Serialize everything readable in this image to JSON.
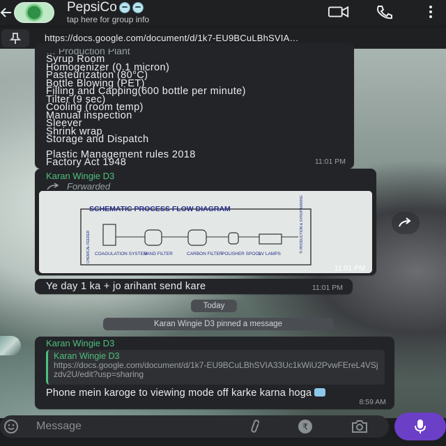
{
  "header": {
    "group_name": "PepsiCo",
    "subtitle": "tap here for group info",
    "icons": [
      "back-arrow-icon",
      "video-call-icon",
      "phone-icon",
      "more-options-icon"
    ]
  },
  "pinned": {
    "text": "https://docs.google.com/document/d/1k7-EU9BCuLBhSVIA…"
  },
  "messages": {
    "m1": {
      "cut_line": "… Production Plant",
      "lines": [
        "Syrup Room",
        "Homogenizer (0.1 micron)",
        "Pasteurization (80°C)",
        "Bottle Blowing (PET)",
        "Filling and Capping(600 bottle per minute)",
        "Tilter (9 sec)",
        "Cooling (room temp)",
        "Manual inspection",
        "Sleever",
        "Shrink wrap",
        "Storage and Dispatch"
      ],
      "lines2": [
        "Plastic Management rules 2018",
        "Factory Act 1948"
      ],
      "time": "11:01 PM"
    },
    "m2": {
      "sender": "Karan Wingie D3",
      "forwarded": "Forwarded",
      "diagram_title": "SCHEMATIC PROCESS FLOW DIAGRAM",
      "diagram_side": "CHEMICAL FEEDER",
      "diagram_right": "TI PRODUCTION & SYRUP MAKING",
      "diagram_labels": [
        "COAGULATION SYSTEM",
        "SAND FILTER",
        "CARBON FILTER",
        "POLISHER SPOOL",
        "UV LAMPS"
      ],
      "time": "11:01 PM"
    },
    "m3": {
      "text": "Ye day 1 ka + jo arihant send kare",
      "time": "11:01 PM"
    },
    "today": "Today",
    "system": "Karan Wingie D3 pinned a message",
    "m4": {
      "sender": "Karan Wingie D3",
      "quote_name": "Karan Wingie D3",
      "quote_text": "https://docs.google.com/document/d/1k7-EU9BCuLBhSVIA33Uc1kWiU2PvwFEreL4VSjzdv2U/edit?usp=sharing",
      "text": "Phone mein karoge to viewing mode off karke karna hoga",
      "time": "8:59 AM"
    }
  },
  "input": {
    "placeholder": "Message",
    "icons": [
      "emoji-icon",
      "attach-icon",
      "rupee-payment-icon",
      "camera-icon",
      "mic-icon"
    ]
  },
  "colors": {
    "sender": "#4fbf7d",
    "mic_button": "#6c3fc7",
    "bubble": "#232428"
  }
}
